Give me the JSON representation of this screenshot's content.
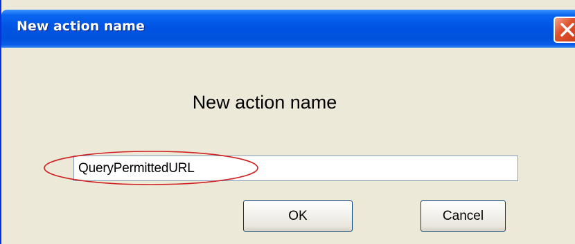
{
  "window": {
    "title": "New action name",
    "close_icon": "close-icon"
  },
  "dialog": {
    "heading": "New action name",
    "input_value": "QueryPermittedURL",
    "ok_label": "OK",
    "cancel_label": "Cancel",
    "annotation_color": "#d02020"
  },
  "colors": {
    "titlebar": "#0054e3",
    "dialog_background": "#ece9d8",
    "close_button": "#e0532f"
  }
}
